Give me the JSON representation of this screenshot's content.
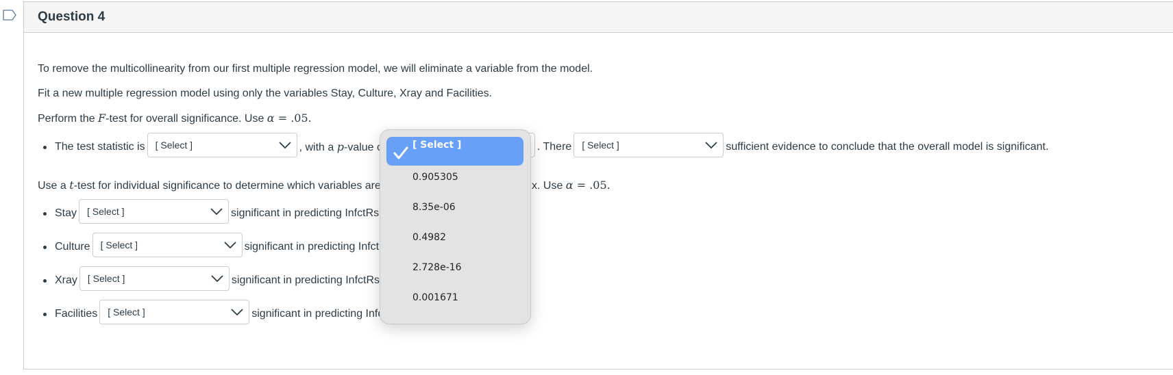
{
  "question": {
    "title": "Question 4",
    "intro1": "To remove the multicollinearity from our first multiple regression model, we will eliminate a variable from the model.",
    "intro2": "Fit a new multiple regression model using only the variables Stay, Culture, Xray and Facilities.",
    "ftest": {
      "pre": "Perform the ",
      "var": "F",
      "post": "-test for overall significance.  Use ",
      "alpha": "α",
      "eq": " = .05."
    },
    "stat_line": {
      "label1": "The test statistic is",
      "select1": "[ Select ]",
      "label2": ", with a ",
      "pvar": "p",
      "label3": "-value o",
      "select2": "[ Select ]",
      "label4": ".  There",
      "select3": "[ Select ]",
      "label5": "sufficient evidence to conclude that the overall model is significant."
    },
    "ttest": {
      "pre": "Use a ",
      "var": "t",
      "mid": "-test for individual significance to determine which variables are",
      "tail_pre": "x.  Use ",
      "alpha": "α",
      "eq": " = .05."
    },
    "variables": [
      {
        "name": "Stay",
        "select": "[ Select ]",
        "suffix": "significant in predicting InfctRsk."
      },
      {
        "name": "Culture",
        "select": "[ Select ]",
        "suffix": "significant in predicting InfctRsk."
      },
      {
        "name": "Xray",
        "select": "[ Select ]",
        "suffix": "significant in predicting InfctRsk."
      },
      {
        "name": "Facilities",
        "select": "[ Select ]",
        "suffix": "significant in predicting InfctRsk."
      }
    ]
  },
  "dropdown": {
    "options": [
      "[ Select ]",
      "0.905305",
      "8.35e-06",
      "0.4982",
      "2.728e-16",
      "0.001671"
    ],
    "selected": "[ Select ]"
  },
  "colors": {
    "highlight": "#69a0f7",
    "text": "#2d3b45",
    "header_bg": "#f5f5f5"
  }
}
